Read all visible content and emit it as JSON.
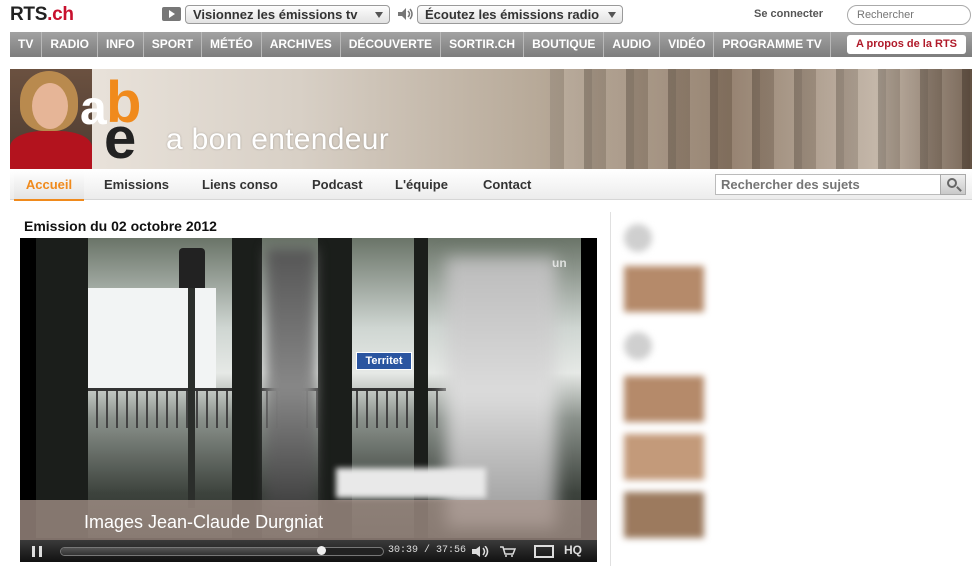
{
  "site": {
    "logo_main": "RTS",
    "logo_dot": ".ch",
    "tv_select": "Visionnez les émissions tv",
    "radio_select": "Écoutez les émissions radio",
    "login": "Se connecter",
    "search_placeholder": "Rechercher"
  },
  "mainnav": {
    "items": [
      "TV",
      "RADIO",
      "INFO",
      "SPORT",
      "MÉTÉO",
      "ARCHIVES",
      "DÉCOUVERTE",
      "SORTIR.CH",
      "BOUTIQUE",
      "AUDIO",
      "VIDÉO",
      "PROGRAMME TV"
    ],
    "apropos": "A propos de la RTS"
  },
  "banner": {
    "logo_a": "a",
    "logo_b": "b",
    "logo_e": "e",
    "title": "a bon entendeur"
  },
  "subnav": {
    "items": [
      "Accueil",
      "Emissions",
      "Liens conso",
      "Podcast",
      "L'équipe",
      "Contact"
    ],
    "search_placeholder": "Rechercher des sujets"
  },
  "episode": {
    "title": "Emission du 02 octobre 2012"
  },
  "video": {
    "sign_text": "Territet",
    "corner_logo": "un",
    "credit": "Images Jean-Claude Durgniat",
    "current_time": "30:39",
    "duration": "37:56",
    "progress": 0.808,
    "hq_label": "HQ"
  },
  "colors": {
    "accent_orange": "#f08a1c",
    "brand_red": "#c8102e",
    "nav_gray": "#8e8e8e"
  }
}
